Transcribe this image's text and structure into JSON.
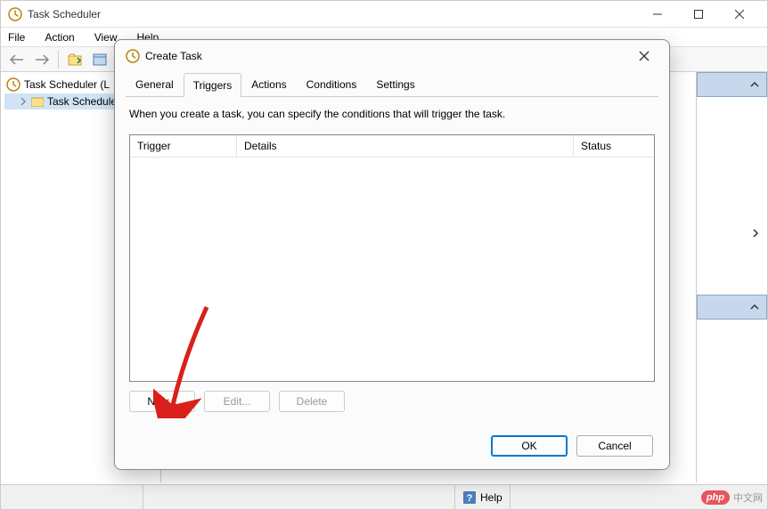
{
  "main": {
    "title": "Task Scheduler",
    "menu": {
      "file": "File",
      "action": "Action",
      "view": "View",
      "help": "Help"
    }
  },
  "tree": {
    "root": "Task Scheduler (L",
    "child": "Task Schedule"
  },
  "status": {
    "help_label": "Help"
  },
  "dialog": {
    "title": "Create Task",
    "tabs": {
      "general": "General",
      "triggers": "Triggers",
      "actions": "Actions",
      "conditions": "Conditions",
      "settings": "Settings"
    },
    "description": "When you create a task, you can specify the conditions that will trigger the task.",
    "columns": {
      "trigger": "Trigger",
      "details": "Details",
      "status": "Status"
    },
    "buttons": {
      "new": "New...",
      "edit": "Edit...",
      "delete": "Delete"
    },
    "footer": {
      "ok": "OK",
      "cancel": "Cancel"
    }
  },
  "watermark": {
    "badge": "php",
    "text": "中文网"
  }
}
